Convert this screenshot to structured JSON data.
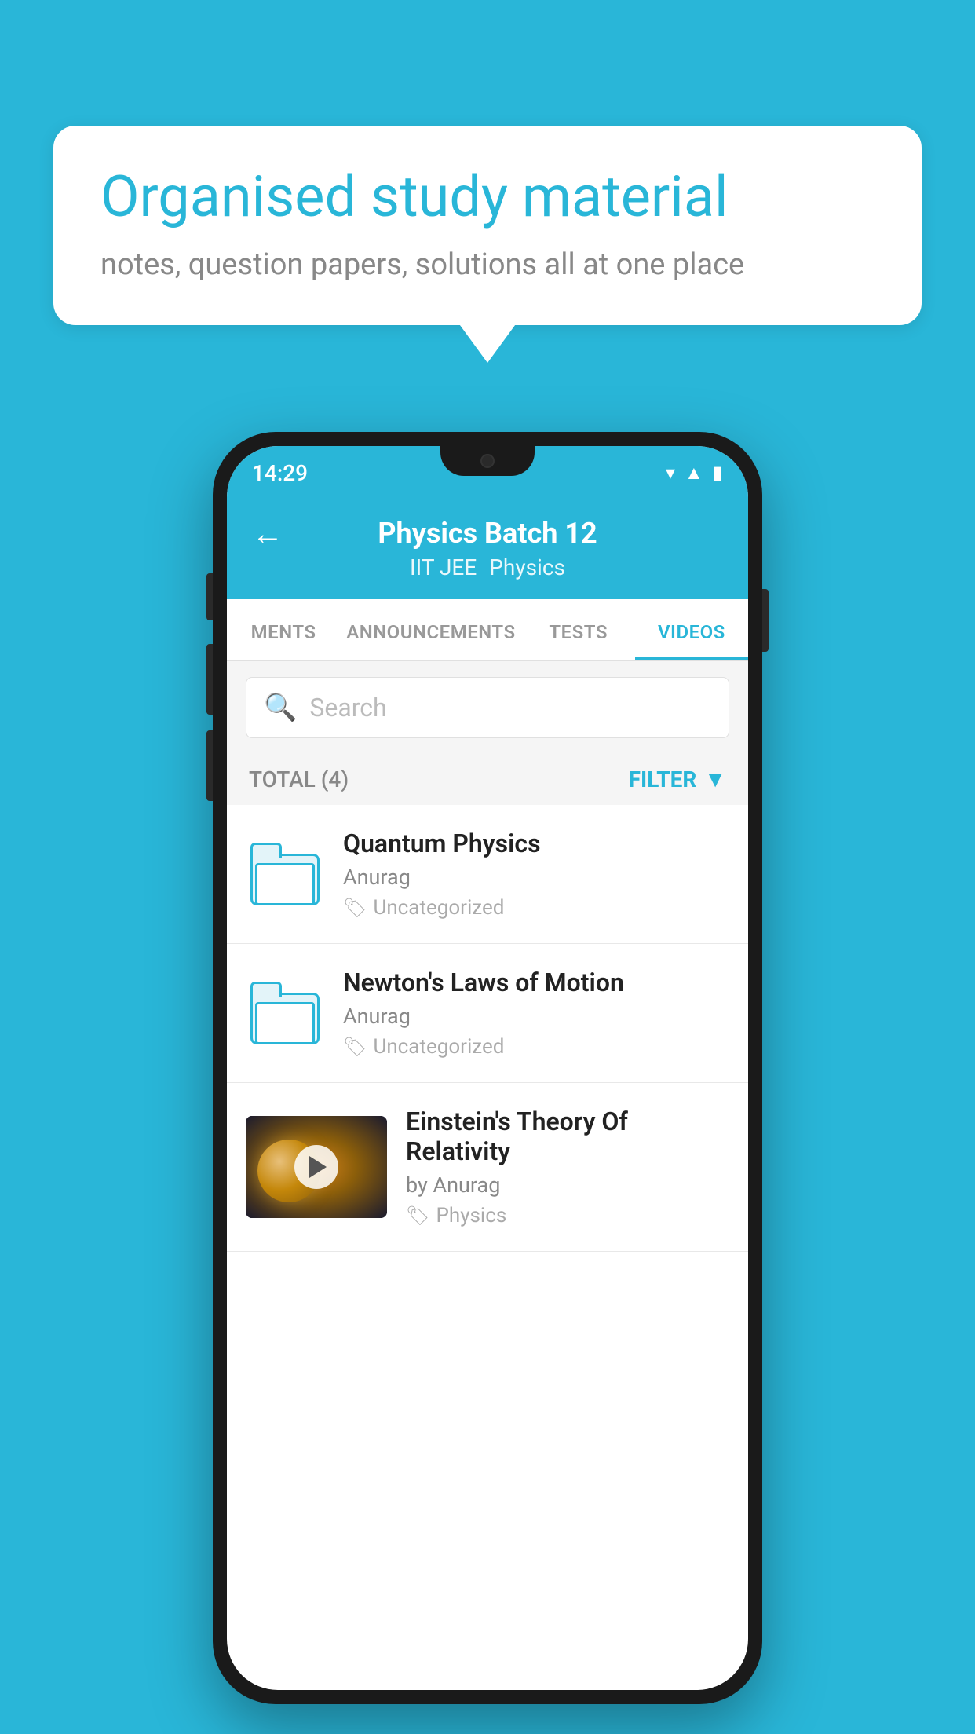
{
  "background_color": "#29b6d8",
  "speech_bubble": {
    "title": "Organised study material",
    "subtitle": "notes, question papers, solutions all at one place"
  },
  "phone": {
    "status_bar": {
      "time": "14:29",
      "wifi": "▾",
      "signal": "▲",
      "battery": "▮"
    },
    "header": {
      "back_label": "←",
      "title": "Physics Batch 12",
      "subtitle1": "IIT JEE",
      "subtitle2": "Physics"
    },
    "tabs": [
      {
        "label": "MENTS",
        "active": false
      },
      {
        "label": "ANNOUNCEMENTS",
        "active": false
      },
      {
        "label": "TESTS",
        "active": false
      },
      {
        "label": "VIDEOS",
        "active": true
      }
    ],
    "search": {
      "placeholder": "Search"
    },
    "filter_row": {
      "total_label": "TOTAL (4)",
      "filter_label": "FILTER"
    },
    "video_list": [
      {
        "id": "1",
        "title": "Quantum Physics",
        "author": "Anurag",
        "tag": "Uncategorized",
        "has_thumbnail": false
      },
      {
        "id": "2",
        "title": "Newton's Laws of Motion",
        "author": "Anurag",
        "tag": "Uncategorized",
        "has_thumbnail": false
      },
      {
        "id": "3",
        "title": "Einstein's Theory Of Relativity",
        "author": "by Anurag",
        "tag": "Physics",
        "has_thumbnail": true
      }
    ]
  }
}
